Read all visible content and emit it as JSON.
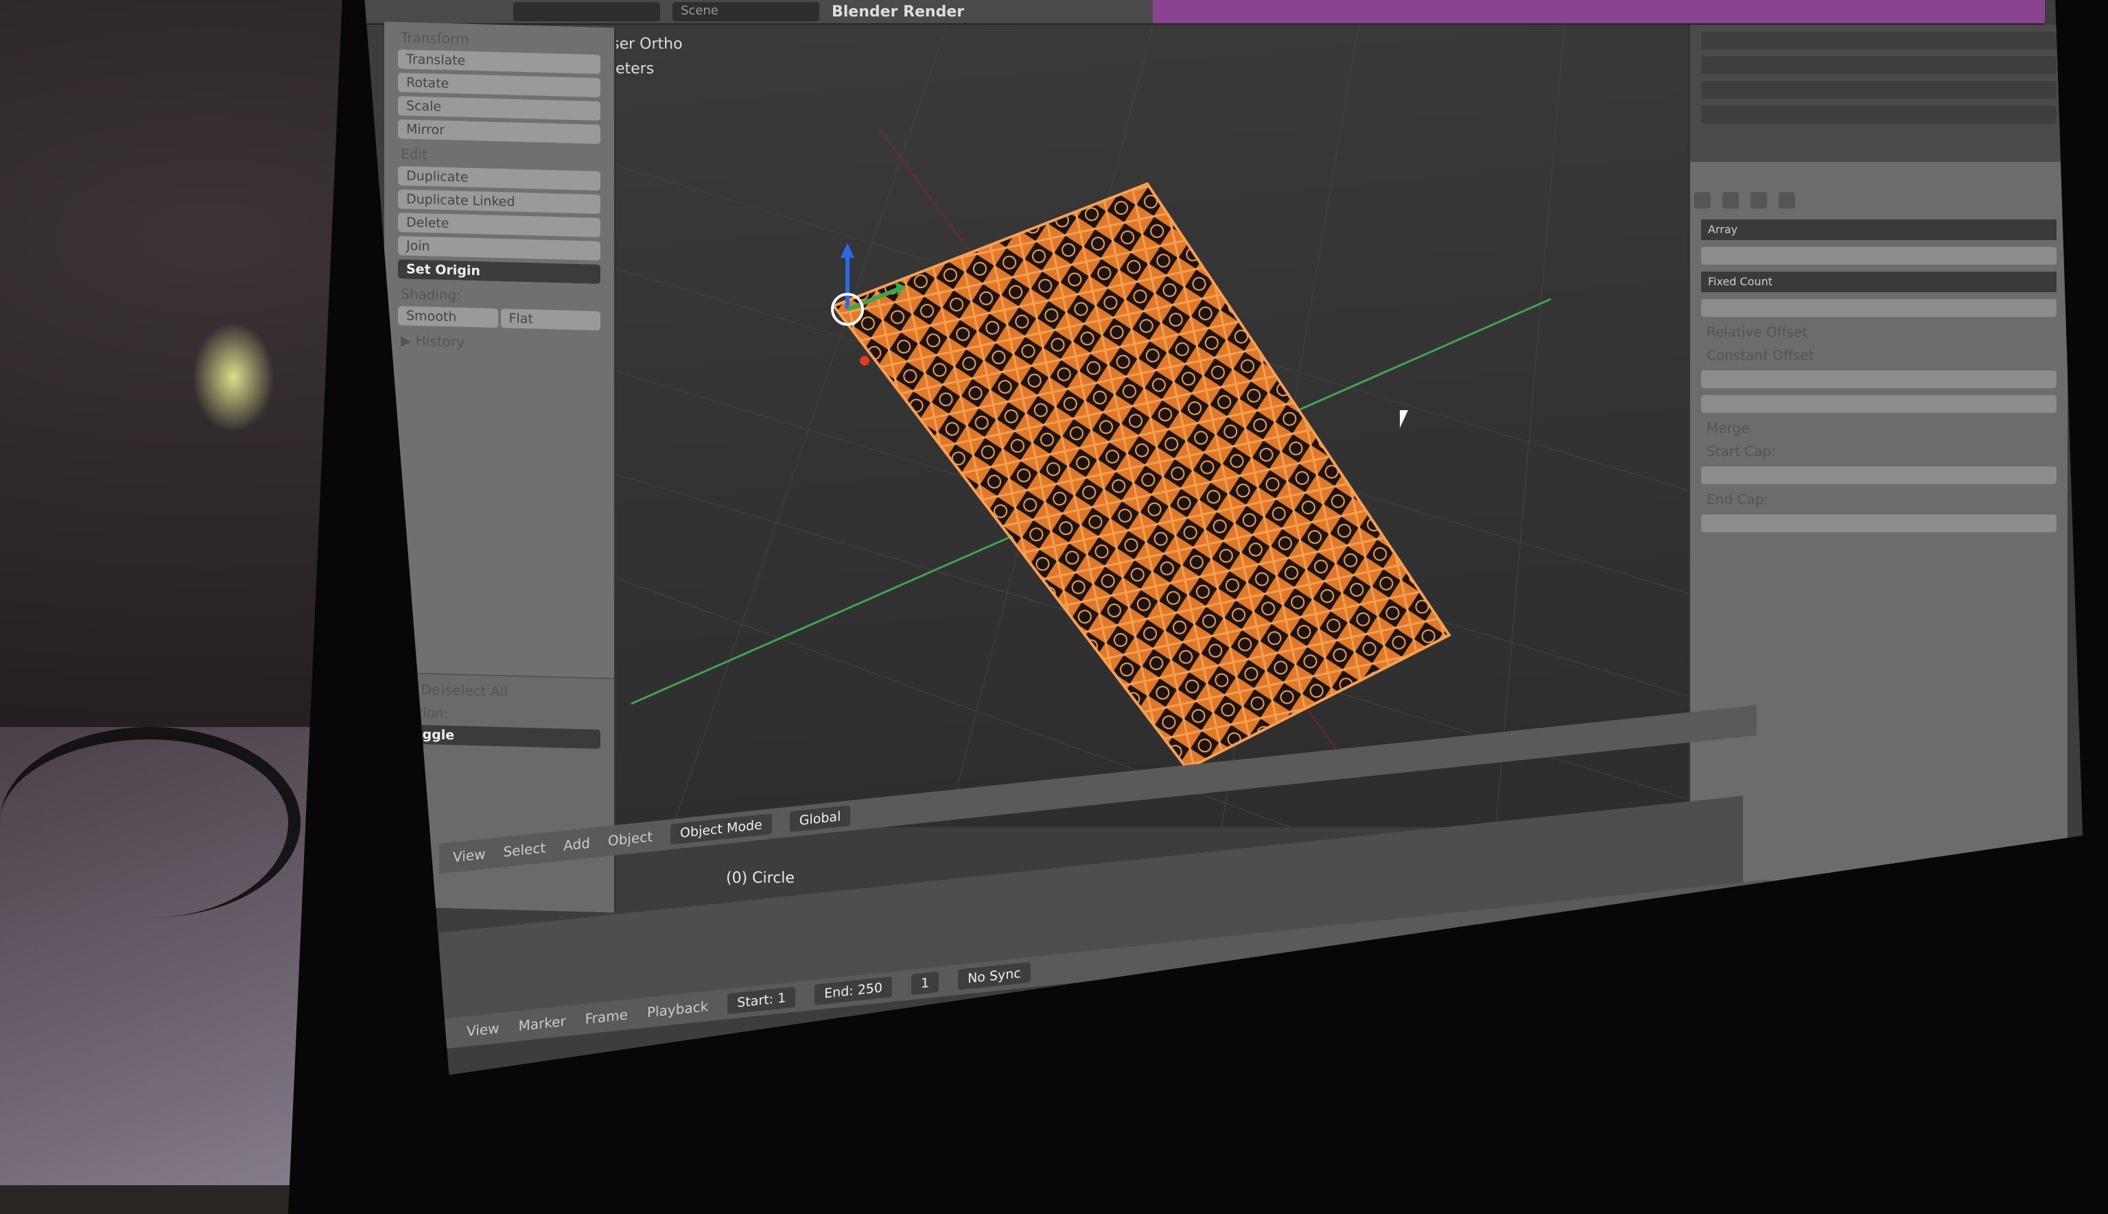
{
  "topbar": {
    "scene_field": "Scene",
    "render_engine": "Blender Render"
  },
  "toolshelf": {
    "transform_header": "Transform",
    "transform_tools": [
      "Translate",
      "Rotate",
      "Scale",
      "Mirror"
    ],
    "edit_header": "Edit",
    "edit_tools": [
      "Duplicate",
      "Duplicate Linked",
      "Delete",
      "Join"
    ],
    "set_origin": "Set Origin",
    "shading_label": "Shading:",
    "smooth": "Smooth",
    "flat": "Flat",
    "history": "History",
    "operator_title": "(De)select All",
    "action_label": "Action:",
    "action_value": "Toggle"
  },
  "viewport": {
    "view_label": "User Ortho",
    "units_label": "Meters",
    "object_name": "(0) Circle"
  },
  "header": {
    "menus": [
      "View",
      "Select",
      "Add",
      "Object"
    ],
    "mode": "Object Mode",
    "orientation": "Global"
  },
  "timeline": {
    "menus": [
      "View",
      "Marker",
      "Frame",
      "Playback"
    ],
    "start_label": "Start:",
    "start_value": "1",
    "end_label": "End:",
    "end_value": "250",
    "current_frame": "1",
    "sync": "No Sync"
  },
  "properties": {
    "modifier_name": "Array",
    "fit_type": "Fixed Count",
    "relative_offset": "Relative Offset",
    "constant_offset": "Constant Offset",
    "merge": "Merge",
    "start_cap": "Start Cap:",
    "end_cap": "End Cap:"
  },
  "colors": {
    "mesh": "#e07a2a",
    "mesh_dark": "#1b1410",
    "x_axis": "#8a2a2a",
    "y_axis": "#3aa84a",
    "selection": "#ff8c1a",
    "ui_bg": "#3d3d3d"
  }
}
